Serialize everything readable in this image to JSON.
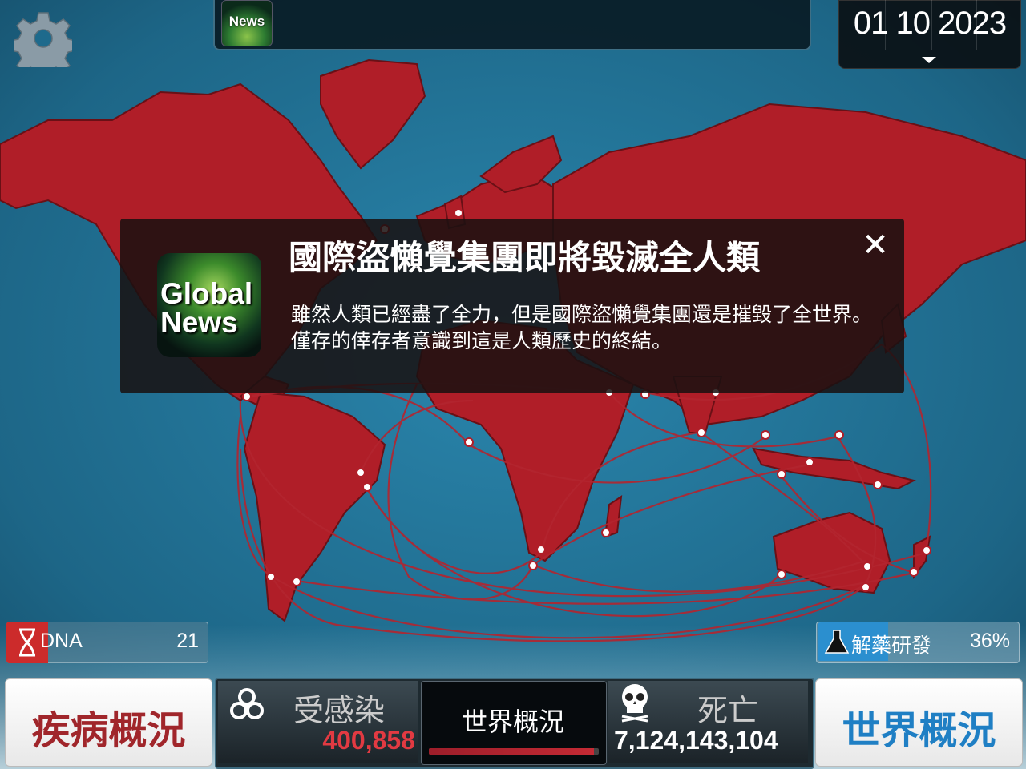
{
  "header": {
    "news_label": "News",
    "date": "01 10 2023"
  },
  "popup": {
    "logo_line1": "Global",
    "logo_line2": "News",
    "title": "國際盜懶覺集團即將毀滅全人類",
    "body": "雖然人類已經盡了全力，但是國際盜懶覺集團還是摧毀了全世界。僅存的倖存者意識到這是人類歷史的終結。",
    "close_icon": "close-icon"
  },
  "resources": {
    "dna_label": "DNA",
    "dna_value": "21",
    "cure_label": "解藥研發",
    "cure_value": "36%"
  },
  "bottom": {
    "disease_button": "疾病概況",
    "infected_label": "受感染",
    "infected_value": "400,858",
    "world_tab": "世界概況",
    "world_progress": 0.97,
    "dead_label": "死亡",
    "dead_value": "7,124,143,104",
    "world_button": "世界概況"
  },
  "colors": {
    "ocean": "#1f6f92",
    "infected_land": "#b8202a",
    "infected_value": "#e23a42",
    "disease_button_text": "#a0262b",
    "world_button_text": "#1f7fc4"
  }
}
